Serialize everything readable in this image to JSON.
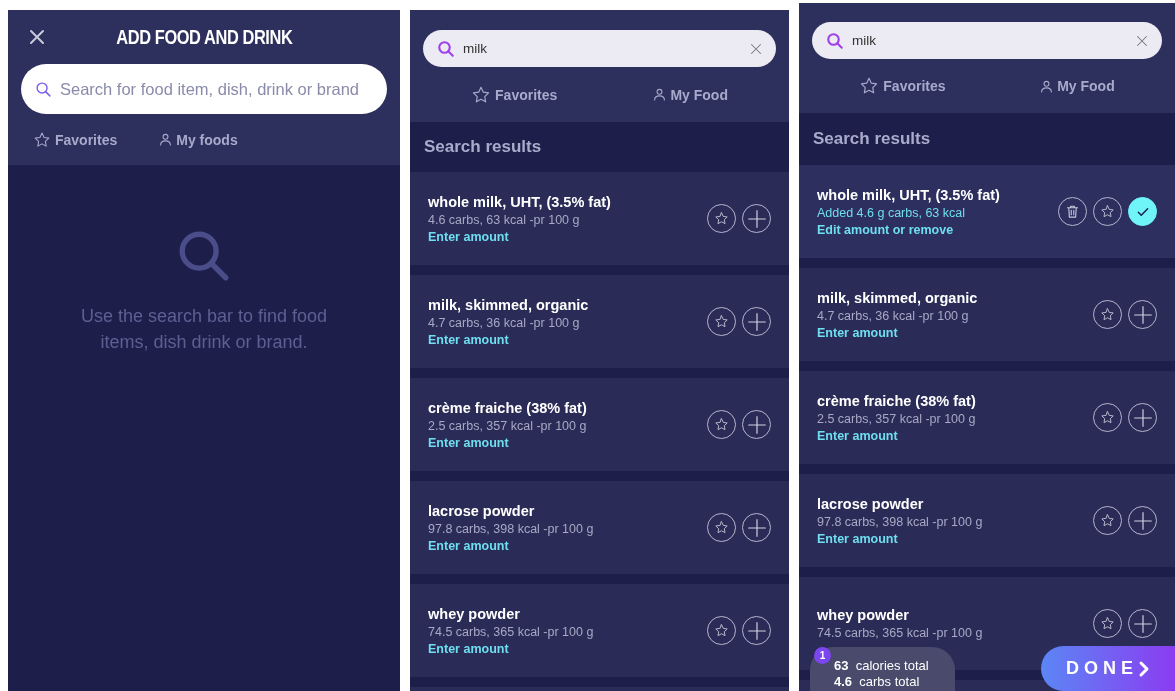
{
  "screens": [
    {
      "kind": "start",
      "title": "ADD FOOD AND DRINK",
      "search": {
        "placeholder": "Search for food item, dish, drink or brand"
      },
      "tabs": [
        {
          "label": "Favorites"
        },
        {
          "label": "My foods"
        }
      ],
      "empty_message": "Use the search bar to find food items, dish drink or brand."
    },
    {
      "kind": "results",
      "search": {
        "value": "milk"
      },
      "tabs": [
        {
          "label": "Favorites"
        },
        {
          "label": "My Food"
        }
      ],
      "section_title": "Search results",
      "results": [
        {
          "name": "whole milk, UHT, (3.5% fat)",
          "detail": "4.6 carbs, 63 kcal -pr 100 g",
          "action": "Enter amount",
          "added": false
        },
        {
          "name": "milk, skimmed, organic",
          "detail": "4.7 carbs, 36 kcal -pr 100 g",
          "action": "Enter amount",
          "added": false
        },
        {
          "name": "crème fraiche (38% fat)",
          "detail": "2.5 carbs, 357 kcal -pr 100 g",
          "action": "Enter amount",
          "added": false
        },
        {
          "name": "lacrose powder",
          "detail": "97.8 carbs, 398 kcal -pr 100 g",
          "action": "Enter amount",
          "added": false
        },
        {
          "name": "whey powder",
          "detail": "74.5 carbs, 365 kcal -pr 100 g",
          "action": "Enter amount",
          "added": false
        }
      ]
    },
    {
      "kind": "results",
      "search": {
        "value": "milk"
      },
      "tabs": [
        {
          "label": "Favorites"
        },
        {
          "label": "My Food"
        }
      ],
      "section_title": "Search results",
      "results": [
        {
          "name": "whole milk, UHT, (3.5% fat)",
          "detail": "Added 4.6 g carbs, 63 kcal",
          "action": "Edit amount or remove",
          "added": true
        },
        {
          "name": "milk, skimmed, organic",
          "detail": "4.7 carbs, 36 kcal -pr 100 g",
          "action": "Enter amount",
          "added": false
        },
        {
          "name": "crème fraiche (38% fat)",
          "detail": "2.5 carbs, 357 kcal -pr 100 g",
          "action": "Enter amount",
          "added": false
        },
        {
          "name": "lacrose powder",
          "detail": "97.8 carbs, 398 kcal -pr 100 g",
          "action": "Enter amount",
          "added": false
        },
        {
          "name": "whey powder",
          "detail": "74.5 carbs, 365 kcal -pr 100 g",
          "added": false
        }
      ],
      "summary": {
        "badge": "1",
        "calories": "63",
        "calories_label": "calories total",
        "carbs": "4.6",
        "carbs_label": "carbs total"
      },
      "done": "DONE"
    }
  ]
}
